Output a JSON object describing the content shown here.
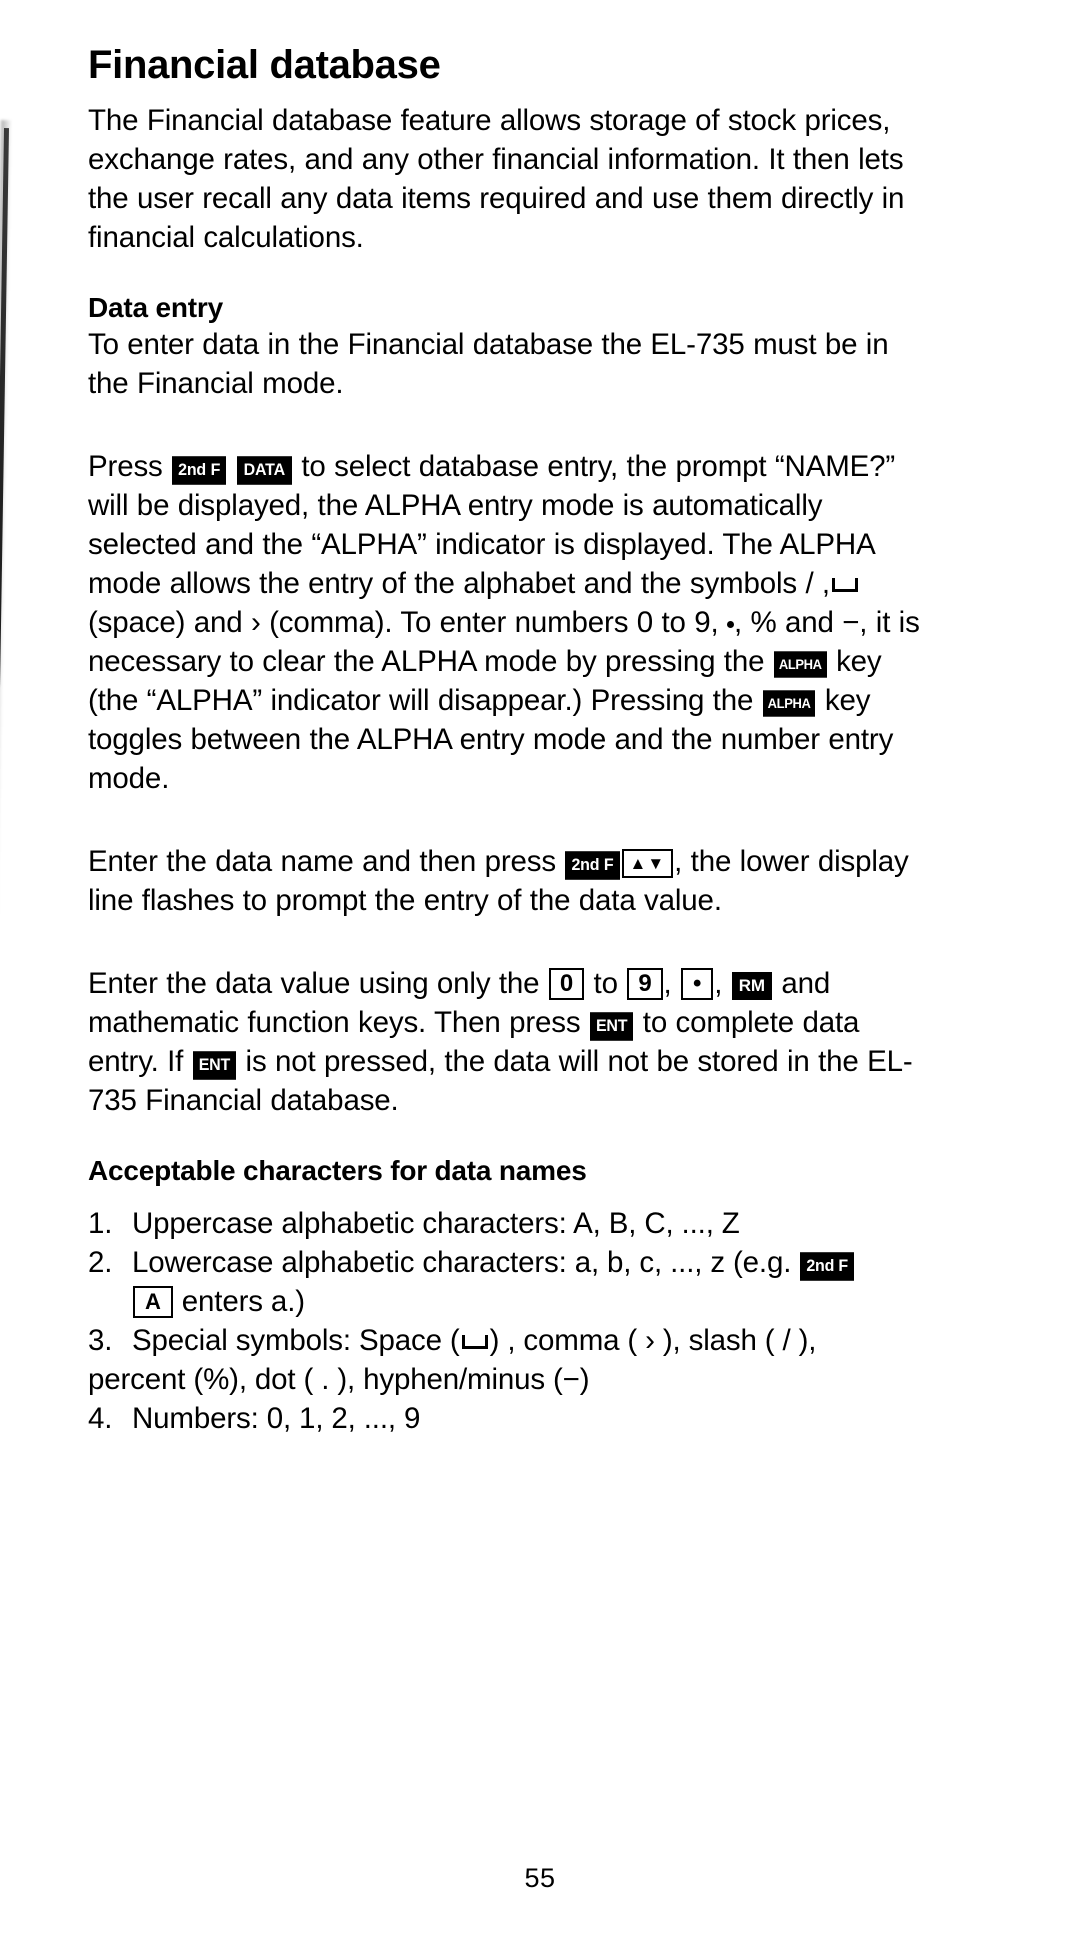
{
  "document": {
    "title": "Financial database",
    "page_number": "55"
  },
  "intro": {
    "paragraph": "The Financial database feature allows storage of stock prices, exchange rates, and any other financial information. It then lets the user recall any data items required and use them directly in financial calculations."
  },
  "data_entry": {
    "heading": "Data entry",
    "paragraph1": "To enter data in the Financial database the EL-735 must be in the Financial mode.",
    "p2_a": "Press",
    "p2_b": "to select database entry, the prompt “NAME?” will be displayed, the ALPHA entry mode is automatically selected and the “ALPHA” indicator is displayed. The ALPHA mode allows the entry of the alphabet and the symbols / ,",
    "p2_c": "(space) and › (comma). To enter numbers 0 to 9,",
    "p2_d": ", % and −, it is necessary to clear the ALPHA mode by pressing the",
    "p2_e": "key (the “ALPHA” indicator will disappear.) Pressing the",
    "p2_f": "key toggles between the ALPHA entry mode and the number entry mode.",
    "p3_a": "Enter the data name and then press",
    "p3_b": ", the lower display line flashes to prompt the entry of the data value.",
    "p4_a": "Enter the data value using only the",
    "p4_b": "to",
    "p4_c": ",",
    "p4_d": ",",
    "p4_e": "and mathematic function keys. Then press",
    "p4_f": "to complete data entry. If",
    "p4_g": "is not pressed, the data will not be stored in the EL-735 Financial database."
  },
  "acceptable": {
    "heading": "Acceptable characters for data names",
    "items": [
      {
        "num": "1.",
        "text": "Uppercase alphabetic characters: A, B, C, ..., Z"
      },
      {
        "num": "2.",
        "text": "Lowercase alphabetic characters: a, b, c, ..., z (e.g.",
        "cont": "enters a.)"
      },
      {
        "num": "3.",
        "text_a": "Special symbols: Space (",
        "text_b": ") , comma ( › ), slash ( / ),",
        "text_c": "percent (%), dot ( . ), hyphen/minus (−)"
      },
      {
        "num": "4.",
        "text": "Numbers: 0, 1, 2, ..., 9"
      }
    ]
  },
  "keys": {
    "second_function": "2nd F",
    "data": "DATA",
    "alpha": "ALPHA",
    "enter": "ENT",
    "zero": "0",
    "nine": "9",
    "dot": "•",
    "rm": "RM",
    "arrows": "▲▼",
    "letter_a": "A"
  }
}
